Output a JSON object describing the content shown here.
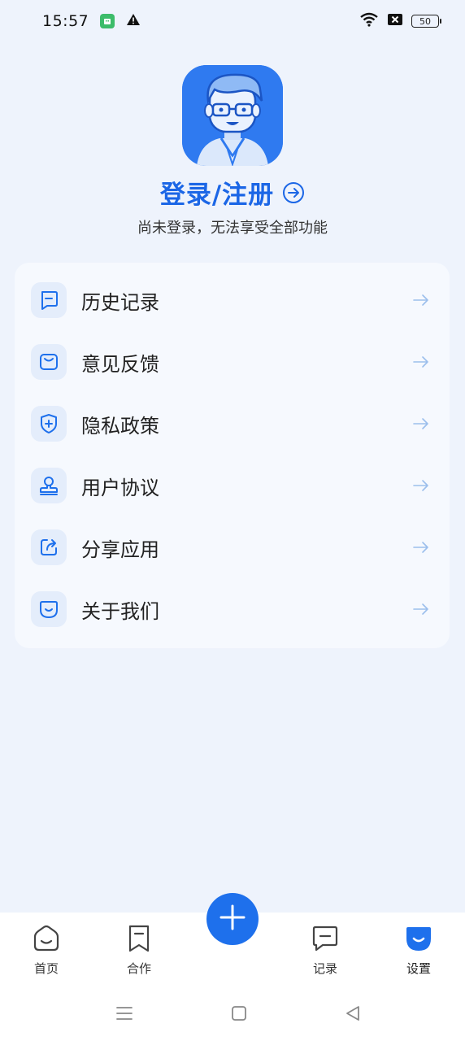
{
  "status_bar": {
    "time": "15:57",
    "battery": "50",
    "icons": [
      "app-notification-icon",
      "warning-icon",
      "wifi-icon",
      "no-sim-icon",
      "battery-icon"
    ]
  },
  "profile": {
    "login_label": "登录/注册",
    "subtitle": "尚未登录，无法享受全部功能"
  },
  "menu": {
    "items": [
      {
        "label": "历史记录",
        "icon": "history-icon"
      },
      {
        "label": "意见反馈",
        "icon": "feedback-icon"
      },
      {
        "label": "隐私政策",
        "icon": "privacy-shield-icon"
      },
      {
        "label": "用户协议",
        "icon": "user-agreement-icon"
      },
      {
        "label": "分享应用",
        "icon": "share-icon"
      },
      {
        "label": "关于我们",
        "icon": "about-icon"
      }
    ]
  },
  "bottom_nav": {
    "items": [
      {
        "label": "首页",
        "icon": "home-icon"
      },
      {
        "label": "合作",
        "icon": "bookmark-icon"
      },
      {
        "label": "记录",
        "icon": "chat-record-icon"
      },
      {
        "label": "设置",
        "icon": "settings-smile-icon"
      }
    ],
    "active_index": 3,
    "fab_icon": "plus-icon"
  },
  "colors": {
    "accent": "#1e70ec",
    "background": "#eef3fc",
    "card": "#f6f9fe",
    "icon_bg": "#e4edfb"
  }
}
